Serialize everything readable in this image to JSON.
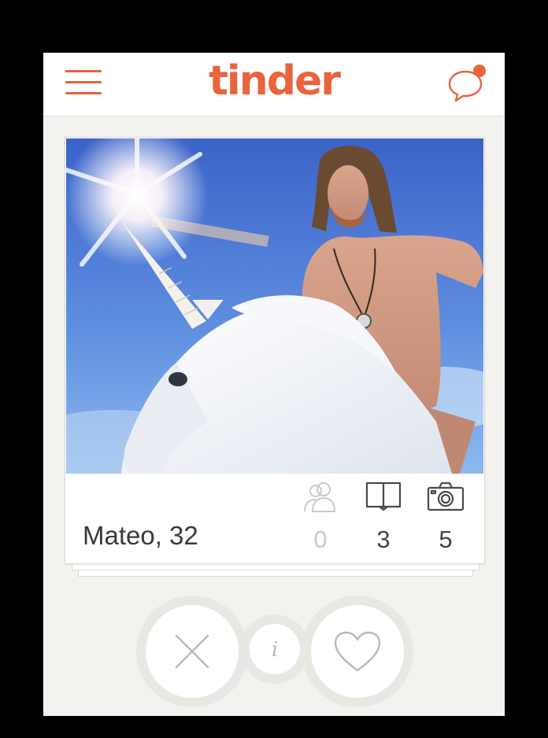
{
  "app": {
    "logo_text": "tinder",
    "brand_color": "#e8643c"
  },
  "navbar": {
    "menu_icon": "hamburger-menu-icon",
    "chat_icon": "chat-bubble-icon",
    "chat_has_notification": true
  },
  "profile": {
    "name_age": "Mateo, 32",
    "stats": [
      {
        "icon": "shared-friends-icon",
        "value": "0"
      },
      {
        "icon": "shared-interests-book-icon",
        "value": "3"
      },
      {
        "icon": "photos-camera-icon",
        "value": "5"
      }
    ]
  },
  "actions": {
    "dislike_icon": "x-icon",
    "info_icon": "info-icon",
    "like_icon": "heart-icon"
  }
}
